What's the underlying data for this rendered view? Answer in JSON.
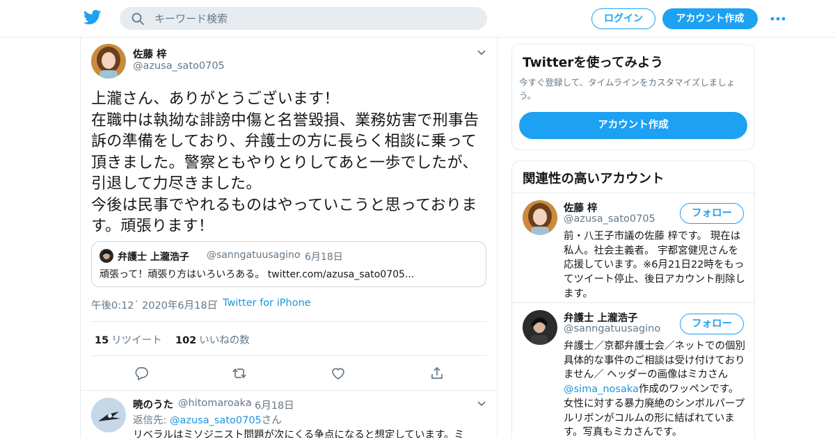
{
  "colors": {
    "accent": "#1da1f2",
    "link": "#1b95e0",
    "muted": "#657786",
    "text": "#14171a",
    "border": "#e6ecf0"
  },
  "header": {
    "logo_icon": "twitter-bird-icon",
    "search": {
      "placeholder": "キーワード検索",
      "value": ""
    },
    "login_label": "ログイン",
    "signup_label": "アカウント作成",
    "more_icon": "more-dots-icon"
  },
  "tweet": {
    "author_name": "佐藤 梓",
    "author_handle": "@azusa_sato0705",
    "text": "上瀧さん、ありがとうございます！\n在職中は執拗な誹謗中傷と名誉毀損、業務妨害で刑事告訴の準備をしており、弁護士の方に長らく相談に乗って頂きました。警察ともやりとりしてあと一歩でしたが、引退して力尽きました。\n今後は民事でやれるものはやっていこうと思っております。頑張ります！",
    "quote": {
      "name": "弁護士 上瀧浩子",
      "handle": "@sanngatuusagino",
      "separator": "·",
      "date": "6月18日",
      "text": "頑張って！頑張り方はいろいろある。 twitter.com/azusa_sato0705..."
    },
    "time": "午後0:12",
    "separator": "·",
    "date": "2020年6月18日",
    "source": "Twitter for iPhone",
    "retweets": {
      "count": "15",
      "label": "リツイート"
    },
    "likes": {
      "count": "102",
      "label": "いいねの数"
    },
    "actions": [
      "reply-icon",
      "retweet-icon",
      "like-icon",
      "share-icon"
    ]
  },
  "reply": {
    "name": "暁のうた",
    "handle": "@hitomaroaka",
    "separator": "·",
    "date": "6月18日",
    "reply_to_prefix": "返信先: ",
    "reply_to_link": "@azusa_sato0705",
    "reply_to_suffix": "さん",
    "text": "リベラルはミソジニスト問題が次にくる争点になると想定しています。ミ"
  },
  "signup_card": {
    "title": "Twitterを使ってみよう",
    "description": "今すぐ登録して、タイムラインをカスタマイズしましょう。",
    "button_label": "アカウント作成"
  },
  "related_card": {
    "title": "関連性の高いアカウント",
    "follow_label": "フォロー",
    "accounts": [
      {
        "name": "佐藤 梓",
        "handle": "@azusa_sato0705",
        "bio": "前・八王子市議の佐藤 梓です。 現在は私人。社会主義者。 宇都宮健児さんを応援しています。※6月21日22時をもってツイート停止、後日アカウント削除します。"
      },
      {
        "name": "弁護士 上瀧浩子",
        "handle": "@sanngatuusagino",
        "bio_before": "弁護士／京都弁護士会／ネットでの個別具体的な事件のご相談は受け付けておりません／ ヘッダーの画像はミカさん",
        "bio_link": "@sima_nosaka",
        "bio_after": "作成のワッペンです。女性に対する暴力廃絶のシンボルパープルリボンがコルムの形に結ばれています。写真もミカさんです。"
      }
    ]
  }
}
